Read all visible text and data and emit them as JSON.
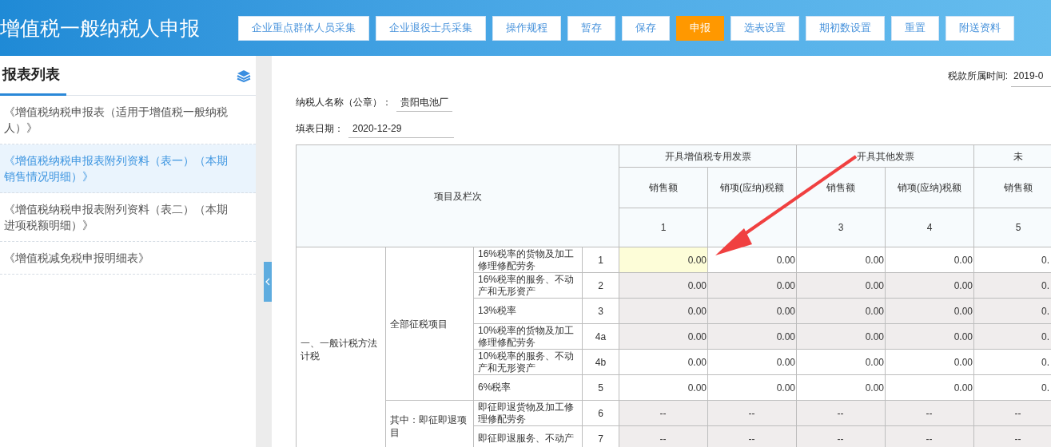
{
  "header": {
    "title": "增值税一般纳税人申报",
    "buttons": [
      {
        "label": "企业重点群体人员采集",
        "selected": false
      },
      {
        "label": "企业退役士兵采集",
        "selected": false
      },
      {
        "label": "操作规程",
        "selected": false
      },
      {
        "label": "暂存",
        "selected": false
      },
      {
        "label": "保存",
        "selected": false
      },
      {
        "label": "申报",
        "selected": true
      },
      {
        "label": "选表设置",
        "selected": false
      },
      {
        "label": "期初数设置",
        "selected": false
      },
      {
        "label": "重置",
        "selected": false
      },
      {
        "label": "附送资料",
        "selected": false
      }
    ]
  },
  "sidebar": {
    "title": "报表列表",
    "items": [
      {
        "label": "《增值税纳税申报表（适用于增值税一般纳税人）》",
        "selected": false
      },
      {
        "label": "《增值税纳税申报表附列资料（表一）（本期销售情况明细）》",
        "selected": true
      },
      {
        "label": "《增值税纳税申报表附列资料（表二）（本期进项税额明细）》",
        "selected": false
      },
      {
        "label": "《增值税减免税申报明细表》",
        "selected": false
      }
    ]
  },
  "form": {
    "period_label": "税款所属时间:",
    "period_value": "2019-0",
    "taxpayer_label": "纳税人名称（公章）：",
    "taxpayer_value": "贵阳电池厂",
    "date_label": "填表日期：",
    "date_value": "2020-12-29"
  },
  "table": {
    "corner": "项目及栏次",
    "column_groups": [
      {
        "label": "开具增值税专用发票",
        "columns": [
          {
            "label": "销售额",
            "number": "1"
          },
          {
            "label": "销项(应纳)税额"
          }
        ]
      },
      {
        "label": "开具其他发票",
        "columns": [
          {
            "label": "销售额",
            "number": "3"
          },
          {
            "label": "销项(应纳)税额",
            "number": "4"
          }
        ]
      },
      {
        "label": "未",
        "columns": [
          {
            "label": "销售额",
            "number": "5"
          }
        ]
      }
    ],
    "sections": [
      {
        "label": "一、一般计税方法计税",
        "groups": [
          {
            "label": "全部征税项目",
            "rows": [
              {
                "label": "16%税率的货物及加工修理修配劳务",
                "line": "1",
                "shaded": false,
                "cells": [
                  {
                    "value": "0.00",
                    "selected": true
                  },
                  {
                    "value": "0.00",
                    "selected": false
                  },
                  {
                    "value": "0.00",
                    "selected": false
                  },
                  {
                    "value": "0.00",
                    "selected": false
                  },
                  {
                    "value": "0.",
                    "selected": false
                  }
                ]
              },
              {
                "label": "16%税率的服务、不动产和无形资产",
                "line": "2",
                "shaded": true,
                "cells": [
                  {
                    "value": "0.00",
                    "selected": false
                  },
                  {
                    "value": "0.00",
                    "selected": false
                  },
                  {
                    "value": "0.00",
                    "selected": false
                  },
                  {
                    "value": "0.00",
                    "selected": false
                  },
                  {
                    "value": "0.",
                    "selected": false
                  }
                ]
              },
              {
                "label": "13%税率",
                "line": "3",
                "shaded": true,
                "cells": [
                  {
                    "value": "0.00",
                    "selected": false
                  },
                  {
                    "value": "0.00",
                    "selected": false
                  },
                  {
                    "value": "0.00",
                    "selected": false
                  },
                  {
                    "value": "0.00",
                    "selected": false
                  },
                  {
                    "value": "0.",
                    "selected": false
                  }
                ]
              },
              {
                "label": "10%税率的货物及加工修理修配劳务",
                "line": "4a",
                "shaded": true,
                "cells": [
                  {
                    "value": "0.00",
                    "selected": false
                  },
                  {
                    "value": "0.00",
                    "selected": false
                  },
                  {
                    "value": "0.00",
                    "selected": false
                  },
                  {
                    "value": "0.00",
                    "selected": false
                  },
                  {
                    "value": "0.",
                    "selected": false
                  }
                ]
              },
              {
                "label": "10%税率的服务、不动产和无形资产",
                "line": "4b",
                "shaded": false,
                "cells": [
                  {
                    "value": "0.00",
                    "selected": false
                  },
                  {
                    "value": "0.00",
                    "selected": false
                  },
                  {
                    "value": "0.00",
                    "selected": false
                  },
                  {
                    "value": "0.00",
                    "selected": false
                  },
                  {
                    "value": "0.",
                    "selected": false
                  }
                ]
              },
              {
                "label": "6%税率",
                "line": "5",
                "shaded": false,
                "cells": [
                  {
                    "value": "0.00",
                    "selected": false
                  },
                  {
                    "value": "0.00",
                    "selected": false
                  },
                  {
                    "value": "0.00",
                    "selected": false
                  },
                  {
                    "value": "0.00",
                    "selected": false
                  },
                  {
                    "value": "0.",
                    "selected": false
                  }
                ]
              }
            ]
          },
          {
            "label": "其中：即征即退项目",
            "rows": [
              {
                "label": "即征即退货物及加工修理修配劳务",
                "line": "6",
                "shaded": true,
                "cells": [
                  {
                    "value": "--",
                    "selected": false
                  },
                  {
                    "value": "--",
                    "selected": false
                  },
                  {
                    "value": "--",
                    "selected": false
                  },
                  {
                    "value": "--",
                    "selected": false
                  },
                  {
                    "value": "--",
                    "selected": false
                  }
                ]
              },
              {
                "label": "即征即退服务、不动产",
                "line": "7",
                "shaded": true,
                "cells": [
                  {
                    "value": "--",
                    "selected": false
                  },
                  {
                    "value": "--",
                    "selected": false
                  },
                  {
                    "value": "--",
                    "selected": false
                  },
                  {
                    "value": "--",
                    "selected": false
                  },
                  {
                    "value": "--",
                    "selected": false
                  }
                ]
              }
            ]
          }
        ]
      }
    ]
  }
}
